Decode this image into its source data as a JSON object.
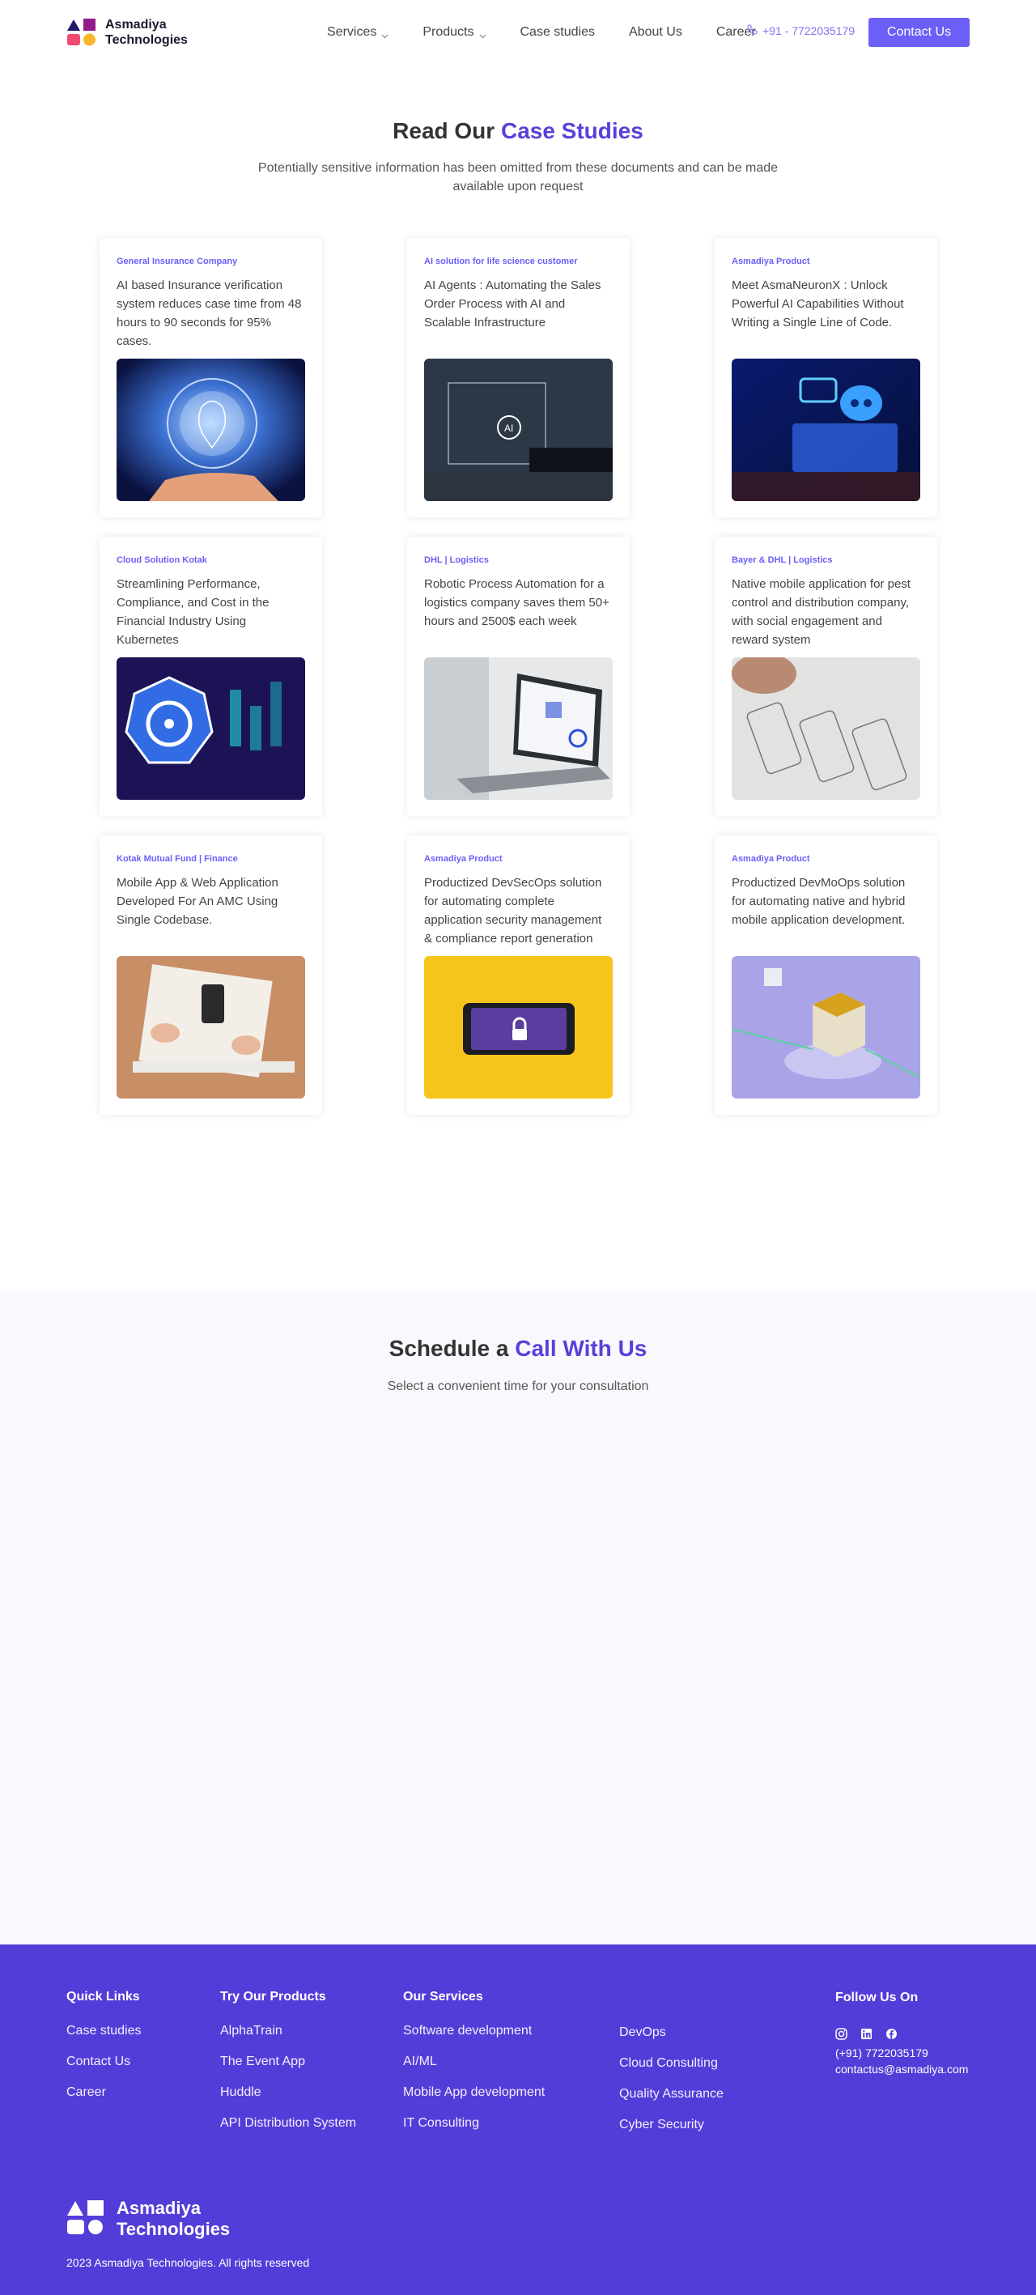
{
  "brand": {
    "name_line1": "Asmadiya",
    "name_line2": "Technologies"
  },
  "nav": {
    "items": [
      "Services",
      "Products",
      "Case studies",
      "About Us",
      "Career"
    ],
    "phone": "+91 - 7722035179",
    "contact_label": "Contact Us"
  },
  "case_studies": {
    "title_plain": "Read Our",
    "title_accent": "Case Studies",
    "subtitle": "Potentially sensitive information has been omitted from these documents and can be made available upon request",
    "cards": [
      {
        "category": "General Insurance Company",
        "title": "AI based Insurance verification system reduces case time from 48 hours to 90 seconds for 95% cases.",
        "image_icon": "brain-globe-image"
      },
      {
        "category": "AI solution for life science customer",
        "title": "AI Agents : Automating the Sales Order Process with AI and Scalable Infrastructure",
        "image_icon": "ai-agent-laptop-image"
      },
      {
        "category": "Asmadiya Product",
        "title": "Meet AsmaNeuronX : Unlock Powerful AI Capabilities Without Writing a Single Line of Code.",
        "image_icon": "robot-chat-image"
      },
      {
        "category": "Cloud Solution Kotak",
        "title": "Streamlining Performance, Compliance, and Cost in the Financial Industry Using Kubernetes",
        "image_icon": "kubernetes-image"
      },
      {
        "category": "DHL | Logistics",
        "title": "Robotic Process Automation for a logistics company saves them 50+ hours and 2500$ each week",
        "image_icon": "laptop-dashboard-image"
      },
      {
        "category": "Bayer & DHL | Logistics",
        "title": "Native mobile application for pest control and distribution company, with social engagement and reward system",
        "image_icon": "wireframe-sketch-image"
      },
      {
        "category": "Kotak Mutual Fund | Finance",
        "title": "Mobile App & Web Application Developed For An AMC Using Single Codebase.",
        "image_icon": "desk-sketching-image"
      },
      {
        "category": "Asmadiya Product",
        "title": "Productized DevSecOps solution for automating complete application security management & compliance report generation",
        "image_icon": "phone-lock-image"
      },
      {
        "category": "Asmadiya Product",
        "title": "Productized DevMoOps solution for automating native and hybrid mobile application development.",
        "image_icon": "chip-cube-image"
      }
    ]
  },
  "schedule": {
    "title_plain": "Schedule a",
    "title_accent": "Call With Us",
    "subtitle": "Select a convenient time for your consultation"
  },
  "footer": {
    "quick_links": {
      "heading": "Quick Links",
      "items": [
        "Case studies",
        "Contact Us",
        "Career"
      ]
    },
    "products": {
      "heading": "Try Our Products",
      "items": [
        "AlphaTrain",
        "The Event App",
        "Huddle",
        "API Distribution System"
      ]
    },
    "services": {
      "heading": "Our Services",
      "col1": [
        "Software development",
        "AI/ML",
        "Mobile App development",
        "IT Consulting"
      ],
      "col2": [
        "DevOps",
        "Cloud Consulting",
        "Quality Assurance",
        "Cyber Security"
      ]
    },
    "follow": {
      "heading": "Follow Us On",
      "phone": "(+91) 7722035179",
      "email": "contactus@asmadiya.com"
    },
    "brand_line1": "Asmadiya",
    "brand_line2": "Technologies",
    "copyright": "2023 Asmadiya Technologies. All rights reserved"
  },
  "colors": {
    "accent": "#5b3fd8",
    "button": "#6b5ff7",
    "footer_bg": "#533dd8"
  }
}
